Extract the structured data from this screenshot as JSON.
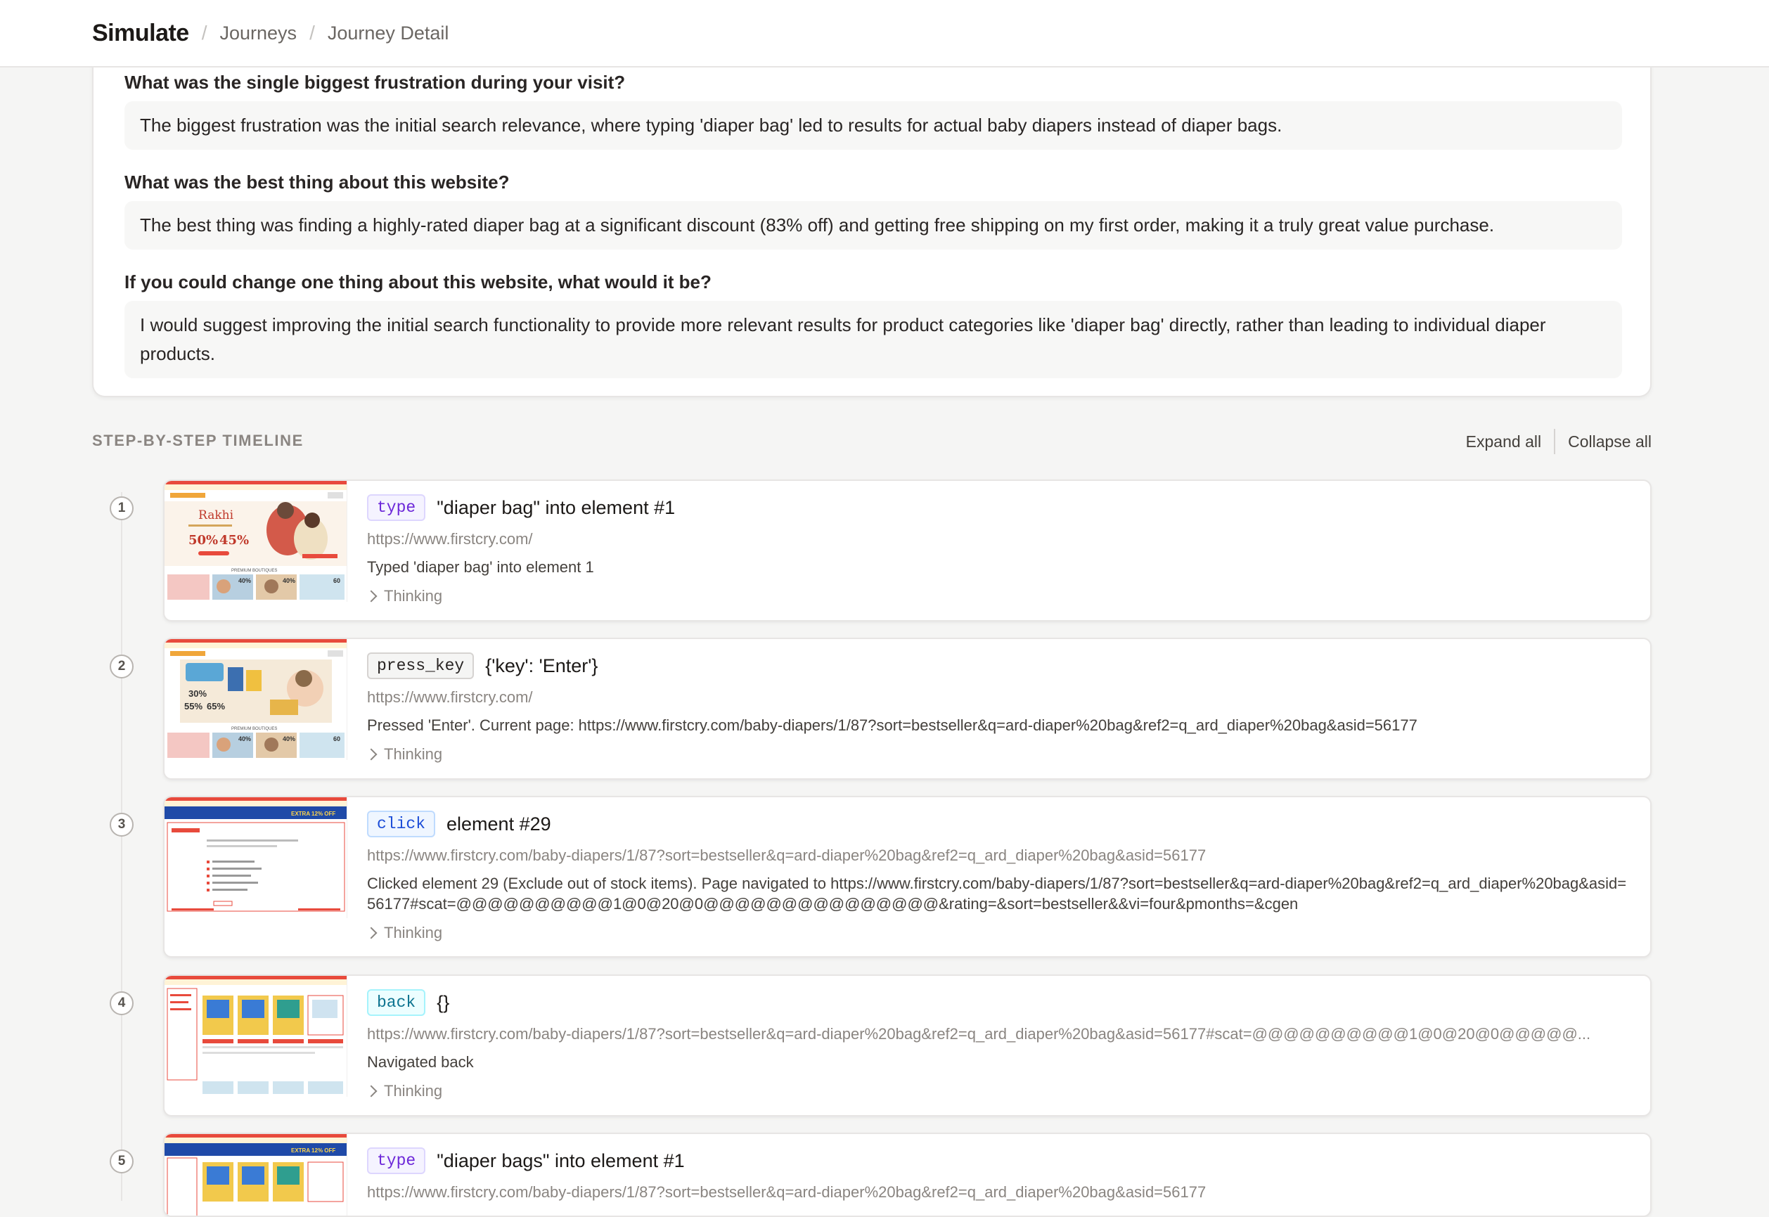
{
  "header": {
    "brand": "Simulate",
    "breadcrumb": [
      "Journeys",
      "Journey Detail"
    ]
  },
  "survey": [
    {
      "question": "What was the single biggest frustration during your visit?",
      "answer": "The biggest frustration was the initial search relevance, where typing 'diaper bag' led to results for actual baby diapers instead of diaper bags."
    },
    {
      "question": "What was the best thing about this website?",
      "answer": "The best thing was finding a highly-rated diaper bag at a significant discount (83% off) and getting free shipping on my first order, making it a truly great value purchase."
    },
    {
      "question": "If you could change one thing about this website, what would it be?",
      "answer": "I would suggest improving the initial search functionality to provide more relevant results for product categories like 'diaper bag' directly, rather than leading to individual diaper products."
    }
  ],
  "timeline": {
    "title": "STEP-BY-STEP TIMELINE",
    "expand_label": "Expand all",
    "collapse_label": "Collapse all",
    "thinking_label": "Thinking",
    "steps": [
      {
        "num": "1",
        "action": "type",
        "title": "\"diaper bag\" into element #1",
        "url": "https://www.firstcry.com/",
        "result": "Typed 'diaper bag' into element 1"
      },
      {
        "num": "2",
        "action": "press_key",
        "title": "{'key': 'Enter'}",
        "url": "https://www.firstcry.com/",
        "result": "Pressed 'Enter'. Current page: https://www.firstcry.com/baby-diapers/1/87?sort=bestseller&q=ard-diaper%20bag&ref2=q_ard_diaper%20bag&asid=56177"
      },
      {
        "num": "3",
        "action": "click",
        "title": "element #29",
        "url": "https://www.firstcry.com/baby-diapers/1/87?sort=bestseller&q=ard-diaper%20bag&ref2=q_ard_diaper%20bag&asid=56177",
        "result": "Clicked element 29 (Exclude out of stock items). Page navigated to https://www.firstcry.com/baby-diapers/1/87?sort=bestseller&q=ard-diaper%20bag&ref2=q_ard_diaper%20bag&asid=56177#scat=@@@@@@@@@@1@0@20@0@@@@@@@@@@@@@@@&rating=&sort=bestseller&&vi=four&pmonths=&cgen"
      },
      {
        "num": "4",
        "action": "back",
        "title": "{}",
        "url": "https://www.firstcry.com/baby-diapers/1/87?sort=bestseller&q=ard-diaper%20bag&ref2=q_ard_diaper%20bag&asid=56177#scat=@@@@@@@@@@1@0@20@0@@@@@...",
        "result": "Navigated back"
      },
      {
        "num": "5",
        "action": "type",
        "title": "\"diaper bags\" into element #1",
        "url": "https://www.firstcry.com/baby-diapers/1/87?sort=bestseller&q=ard-diaper%20bag&ref2=q_ard_diaper%20bag&asid=56177",
        "result": ""
      }
    ]
  },
  "thumbnails": {
    "home_banner": {
      "brand_text": "Rakhi",
      "offer_1": "50%",
      "offer_2": "45%",
      "section_label": "PREMIUM BOUTIQUES",
      "tile_1": "40%",
      "tile_2": "40%",
      "tile_3": "60"
    },
    "diaper_banner": {
      "offer_1": "30%",
      "offer_2": "55%",
      "offer_3": "65%",
      "section_label": "PREMIUM BOUTIQUES",
      "tile_1": "40%",
      "tile_2": "40%",
      "tile_3": "60"
    },
    "results_banner": {
      "promo": "EXTRA 12% OFF"
    }
  },
  "colors": {
    "type_badge": "#6d28d9",
    "press_key_badge": "#292524",
    "click_badge": "#1d4ed8",
    "back_badge": "#0e7490"
  }
}
